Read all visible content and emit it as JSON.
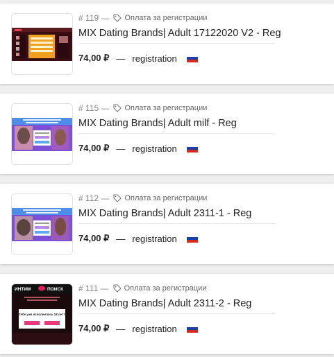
{
  "offers": [
    {
      "num": "# 119 —",
      "category": "Оплата за регистрации",
      "title": "MIX Dating Brands| Adult 17122020 V2 - Reg",
      "price": "74,00 ₽",
      "dash": "—",
      "type": "registration",
      "thumb": "dark-dating-site-screenshot"
    },
    {
      "num": "# 115 —",
      "category": "Оплата за регистрации",
      "title": "MIX Dating Brands| Adult milf - Reg",
      "price": "74,00 ₽",
      "dash": "—",
      "type": "registration",
      "thumb": "purple-landing-screenshot"
    },
    {
      "num": "# 112 —",
      "category": "Оплата за регистрации",
      "title": "MIX Dating Brands| Adult 2311-1 - Reg",
      "price": "74,00 ₽",
      "dash": "—",
      "type": "registration",
      "thumb": "purple-landing-screenshot"
    },
    {
      "num": "# 111 —",
      "category": "Оплата за регистрации",
      "title": "MIX Dating Brands| Adult 2311-2 - Reg",
      "price": "74,00 ₽",
      "dash": "—",
      "type": "registration",
      "thumb": "intim-poisk-screenshot",
      "thumb_text": {
        "logo_left": "ИНТИМ",
        "logo_right": "ПОИСК",
        "question": "Тебе уже исполнилось 18 лет?"
      }
    }
  ],
  "colors": {
    "card": "#ffffff",
    "background": "#eeeeee",
    "flag_white": "#ffffff",
    "flag_blue": "#1c3fa8",
    "flag_red": "#d52b1e"
  }
}
